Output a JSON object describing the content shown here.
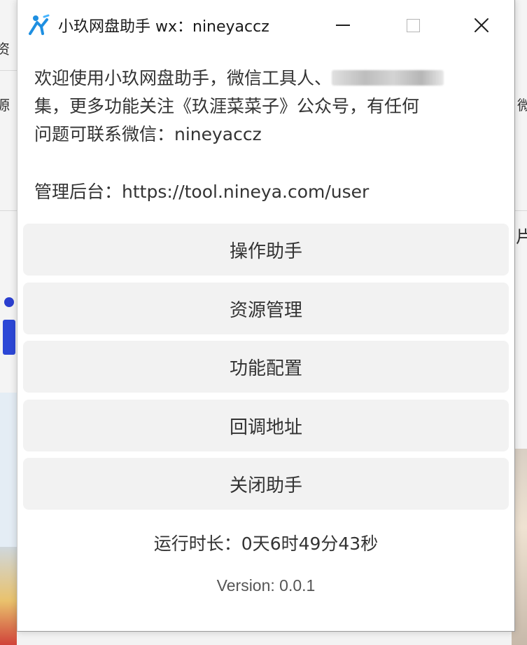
{
  "window": {
    "title": "小玖网盘助手 wx：nineyaccz",
    "controls": {
      "minimize_icon": "minimize-icon",
      "maximize_icon": "maximize-icon",
      "close_icon": "close-icon"
    }
  },
  "intro": {
    "line1_prefix": "欢迎使用小玖网盘助手，微信工具人、",
    "line2": "集，更多功能关注《玖涯菜菜子》公众号，有任何",
    "line3": "问题可联系微信：nineyaccz"
  },
  "admin": {
    "text": "管理后台：https://tool.nineya.com/user"
  },
  "buttons": [
    {
      "label": "操作助手"
    },
    {
      "label": "资源管理"
    },
    {
      "label": "功能配置"
    },
    {
      "label": "回调地址"
    },
    {
      "label": "关闭助手"
    }
  ],
  "status": {
    "runtime": "运行时长：0天6时49分43秒",
    "version": "Version: 0.0.1"
  },
  "background": {
    "left_glyphs": [
      "资",
      "源"
    ],
    "right_glyphs": [
      "微",
      "片"
    ]
  },
  "colors": {
    "button_bg": "#f2f2f2",
    "text": "#333333",
    "accent_icon": "#1e8fe1"
  }
}
